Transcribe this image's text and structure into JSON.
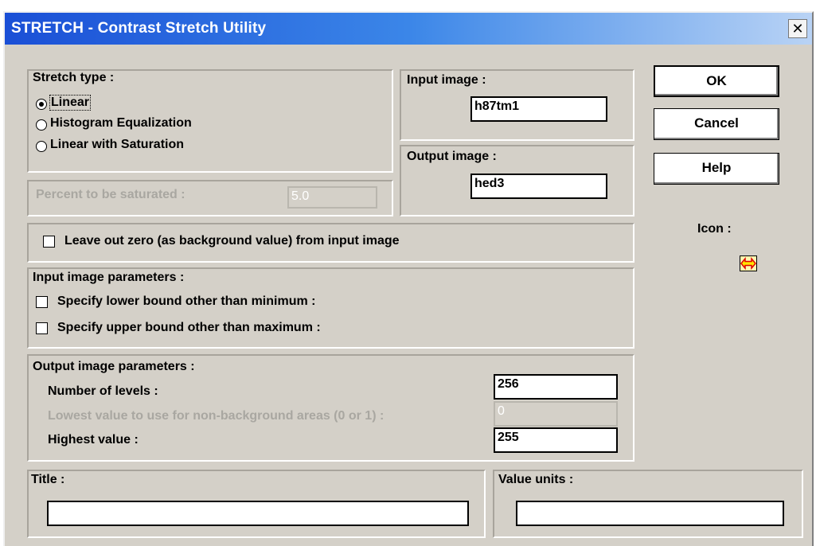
{
  "window": {
    "title": "STRETCH - Contrast Stretch Utility",
    "close_glyph": "✕"
  },
  "stretch_type": {
    "label": "Stretch type :",
    "options": [
      "Linear",
      "Histogram Equalization",
      "Linear with Saturation"
    ],
    "selected": "Linear"
  },
  "percent_saturated": {
    "label": "Percent to be saturated :",
    "value": "5.0"
  },
  "input_image": {
    "label": "Input image :",
    "value": "h87tm1"
  },
  "output_image": {
    "label": "Output image :",
    "value": "hed3"
  },
  "buttons": {
    "ok": "OK",
    "cancel": "Cancel",
    "help": "Help"
  },
  "icon": {
    "label": "Icon :",
    "name": "double-arrow-icon",
    "colors": {
      "fill": "#fff6b0",
      "arrow": "#ff0000"
    }
  },
  "leave_out_zero": {
    "label": "Leave out zero (as background value) from input image",
    "checked": false
  },
  "input_params": {
    "label": "Input image parameters :",
    "lower": "Specify lower bound other than minimum :",
    "upper": "Specify upper bound other than maximum :"
  },
  "output_params": {
    "label": "Output image parameters :",
    "levels_label": "Number of levels :",
    "levels_value": "256",
    "lowest_label": "Lowest value to use for non-background areas (0 or 1) :",
    "lowest_value": "0",
    "highest_label": "Highest value :",
    "highest_value": "255"
  },
  "title_field": {
    "label": "Title :",
    "value": ""
  },
  "value_units": {
    "label": "Value units :",
    "value": ""
  },
  "colors": {
    "titlebar_start": "#1a4fd6",
    "titlebar_end": "#b9d3f5",
    "dialog_bg": "#d4d0c8"
  }
}
